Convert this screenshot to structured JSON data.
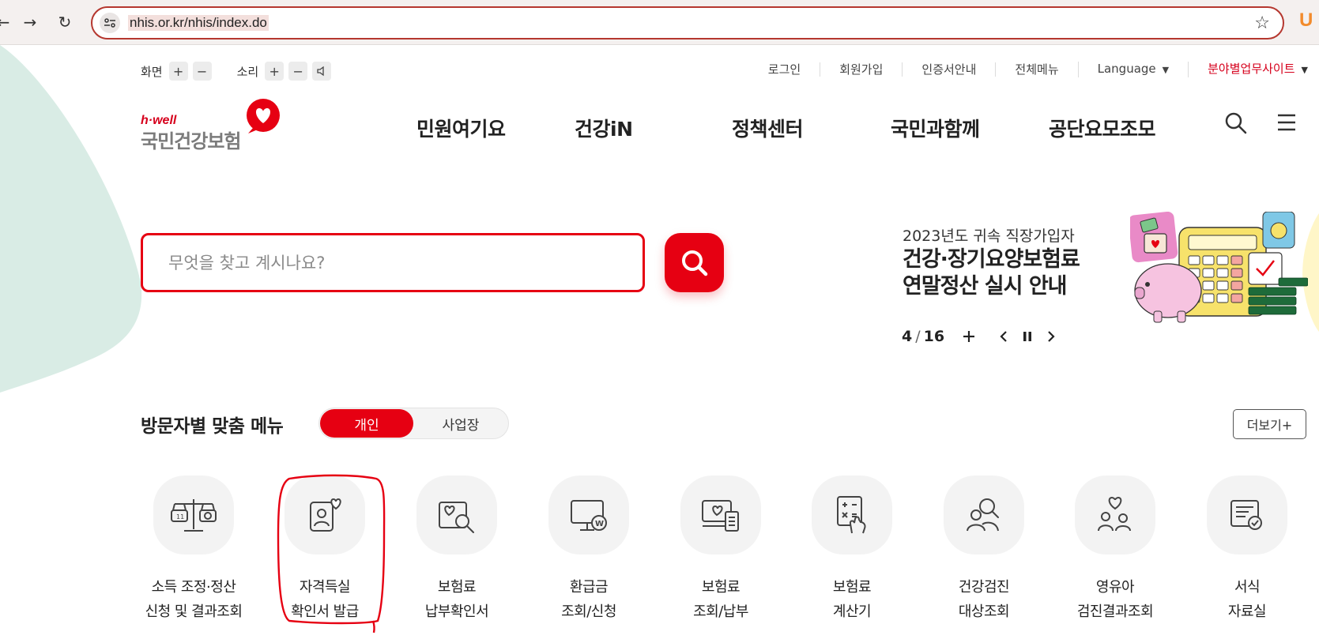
{
  "browser": {
    "url": "nhis.or.kr/nhis/index.do",
    "profile_letter": "U"
  },
  "utility": {
    "screen_label": "화면",
    "sound_label": "소리",
    "links": [
      "로그인",
      "회원가입",
      "인증서안내",
      "전체메뉴"
    ],
    "language": "Language",
    "site_link": "분야별업무사이트"
  },
  "logo": {
    "tagline": "h·well",
    "name": "국민건강보험"
  },
  "gnb": [
    "민원여기요",
    "건강iN",
    "정책센터",
    "국민과함께",
    "공단요모조모"
  ],
  "search": {
    "placeholder": "무엇을 찾고 계시나요?"
  },
  "banner": {
    "subtitle": "2023년도 귀속 직장가입자",
    "title_line1": "건강·장기요양보험료",
    "title_line2": "연말정산 실시 안내",
    "current": "4",
    "separator": "/",
    "total": "16"
  },
  "visitor_menu": {
    "title": "방문자별 맞춤 메뉴",
    "tab_personal": "개인",
    "tab_business": "사업장",
    "more": "더보기+",
    "items": [
      {
        "icon": "scale-icon",
        "line1": "소득 조정·정산",
        "line2": "신청 및 결과조회"
      },
      {
        "icon": "id-card-heart-icon",
        "line1": "자격득실",
        "line2": "확인서 발급"
      },
      {
        "icon": "search-document-icon",
        "line1": "보험료",
        "line2": "납부확인서"
      },
      {
        "icon": "monitor-won-icon",
        "line1": "환급금",
        "line2": "조회/신청"
      },
      {
        "icon": "monitor-receipt-icon",
        "line1": "보험료",
        "line2": "조회/납부"
      },
      {
        "icon": "calculator-icon",
        "line1": "보험료",
        "line2": "계산기"
      },
      {
        "icon": "people-checkup-icon",
        "line1": "건강검진",
        "line2": "대상조회"
      },
      {
        "icon": "family-heart-icon",
        "line1": "영유아",
        "line2": "검진결과조회"
      },
      {
        "icon": "form-check-icon",
        "line1": "서식",
        "line2": "자료실"
      }
    ]
  },
  "colors": {
    "brand_red": "#e60012",
    "bg_mint": "#d9ece5",
    "annotation_red": "#e60012"
  }
}
